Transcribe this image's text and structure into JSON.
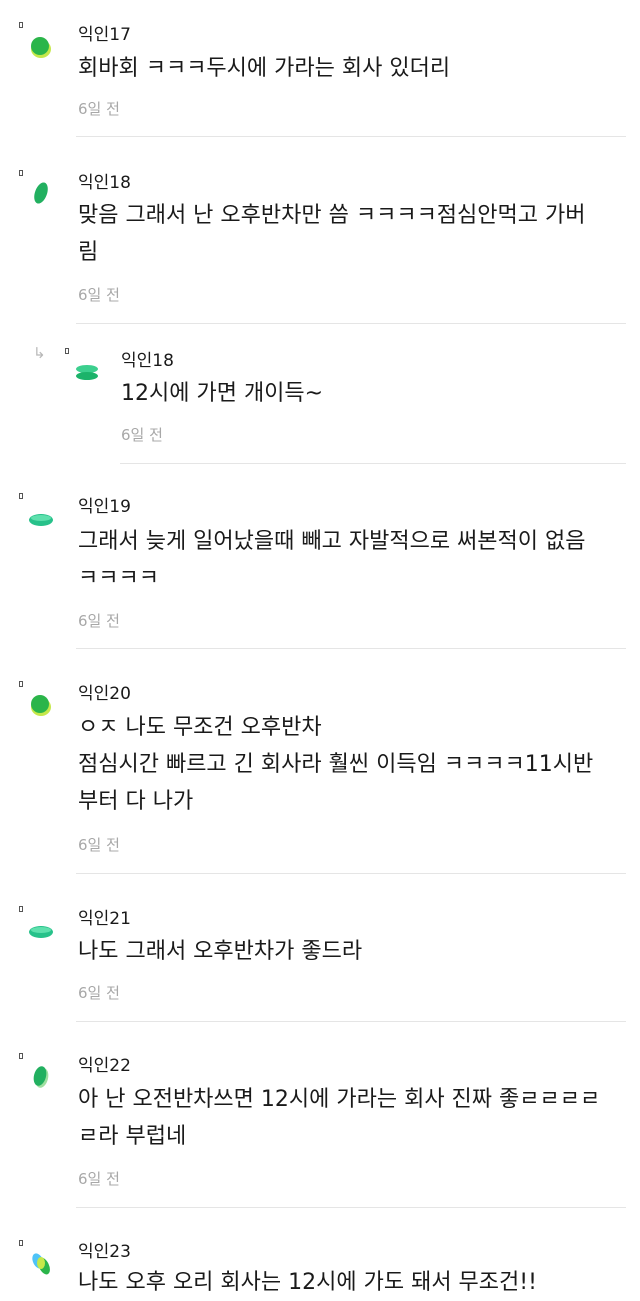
{
  "comments": [
    {
      "author": "익인17",
      "text": "회바회 ㅋㅋㅋ두시에 가라는 회사 있더리",
      "time": "6일 전",
      "avatar_colors": [
        "#2bb54a",
        "#c5e84a"
      ]
    },
    {
      "author": "익인18",
      "text": "맞음 그래서 난 오후반차만 씀 ㅋㅋㅋㅋ점심안먹고 가버\n림",
      "time": "6일 전",
      "avatar_colors": [
        "#22b060",
        "#18a76c"
      ]
    },
    {
      "author": "익인18",
      "text": "12시에 가면 개이득~",
      "time": "6일 전",
      "avatar_colors": [
        "#1cb36a",
        "#3ccf8e"
      ]
    },
    {
      "author": "익인19",
      "text": "그래서 늦게 일어났을때 빼고 자발적으로 써본적이 없음\nㅋㅋㅋㅋ",
      "time": "6일 전",
      "avatar_colors": [
        "#27c18a",
        "#1aa876"
      ]
    },
    {
      "author": "익인20",
      "text": "ㅇㅈ 나도 무조건 오후반차\n점심시간 빠르고 긴 회사라 훨씬 이득임 ㅋㅋㅋㅋ11시반\n부터 다 나가",
      "time": "6일 전",
      "avatar_colors": [
        "#2bb54a",
        "#c5e84a"
      ]
    },
    {
      "author": "익인21",
      "text": "나도 그래서 오후반차가 좋드라",
      "time": "6일 전",
      "avatar_colors": [
        "#27c18a",
        "#1aa876"
      ]
    },
    {
      "author": "익인22",
      "text": "아 난 오전반차쓰면 12시에 가라는 회사 진짜 좋ㄹㄹㄹㄹ\nㄹ라 부럽네",
      "time": "6일 전",
      "avatar_colors": [
        "#22b060",
        "#9fe0a0"
      ]
    },
    {
      "author": "익인23",
      "text": "나도 오후 오리 회사는 12시에 가도 돼서 무조건!!",
      "time": "",
      "avatar_colors": [
        "#2bb54a",
        "#4fc3f7"
      ]
    }
  ]
}
